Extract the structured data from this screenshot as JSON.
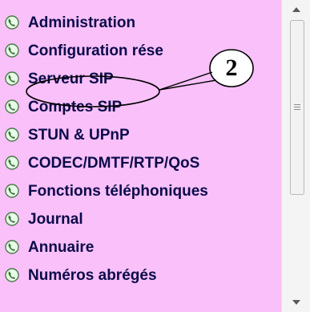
{
  "menu": {
    "items": [
      {
        "label": "Administration"
      },
      {
        "label": "Configuration rése"
      },
      {
        "label": "Serveur SIP"
      },
      {
        "label": "Comptes SIP"
      },
      {
        "label": "STUN & UPnP"
      },
      {
        "label": "CODEC/DMTF/RTP/QoS"
      },
      {
        "label": "Fonctions téléphoniques"
      },
      {
        "label": "Journal"
      },
      {
        "label": "Annuaire"
      },
      {
        "label": "Numéros abrégés"
      }
    ]
  },
  "annotation": {
    "callout_number": "2"
  },
  "colors": {
    "panel_background": "#f9c0f9",
    "label_text": "#0b0b4a",
    "icon_fill": "#e6ffe6",
    "icon_stroke": "#4a7a4a"
  },
  "icons": {
    "menu_item_icon": "phone-globe-icon",
    "scroll_up": "scroll-up-arrow-icon",
    "scroll_down": "scroll-down-arrow-icon"
  }
}
